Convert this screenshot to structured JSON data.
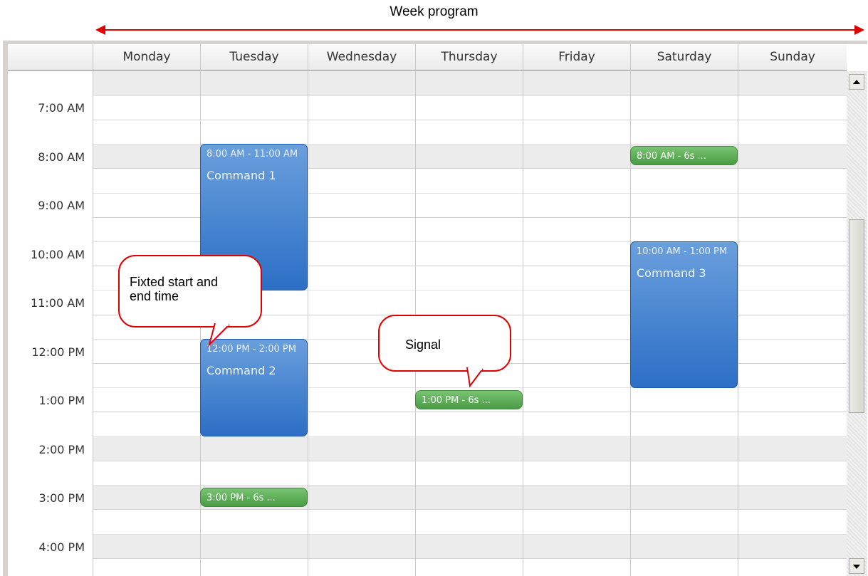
{
  "title": "Week program",
  "colors": {
    "annotation_red": "#e00000",
    "command_blue": "#2c6fc6",
    "signal_green": "#4a9c45",
    "header_bg": "#f0f0f0"
  },
  "days": [
    "Monday",
    "Tuesday",
    "Wednesday",
    "Thursday",
    "Friday",
    "Saturday",
    "Sunday"
  ],
  "time_labels": [
    "7:00 AM",
    "8:00 AM",
    "9:00 AM",
    "10:00 AM",
    "11:00 AM",
    "12:00 PM",
    "1:00 PM",
    "2:00 PM",
    "3:00 PM",
    "4:00 PM"
  ],
  "appointments": [
    {
      "day": "Tuesday",
      "time_text": "8:00 AM - 11:00 AM",
      "subject": "Command 1"
    },
    {
      "day": "Tuesday",
      "time_text": "12:00 PM - 2:00 PM",
      "subject": "Command 2"
    },
    {
      "day": "Saturday",
      "time_text": "10:00 AM - 1:00 PM",
      "subject": "Command 3"
    }
  ],
  "signals": [
    {
      "day": "Saturday",
      "text": "8:00 AM - 6s ..."
    },
    {
      "day": "Thursday",
      "text": "1:00 PM - 6s ..."
    },
    {
      "day": "Tuesday",
      "text": "3:00 PM - 6s ..."
    }
  ],
  "callouts": [
    {
      "text_line1": "Fixted start and",
      "text_line2": "end time"
    },
    {
      "text_line1": "Signal"
    }
  ],
  "icons": {
    "scroll_up": "triangle-up-icon",
    "scroll_down": "triangle-down-icon",
    "arrow": "double-headed-arrow-icon"
  }
}
